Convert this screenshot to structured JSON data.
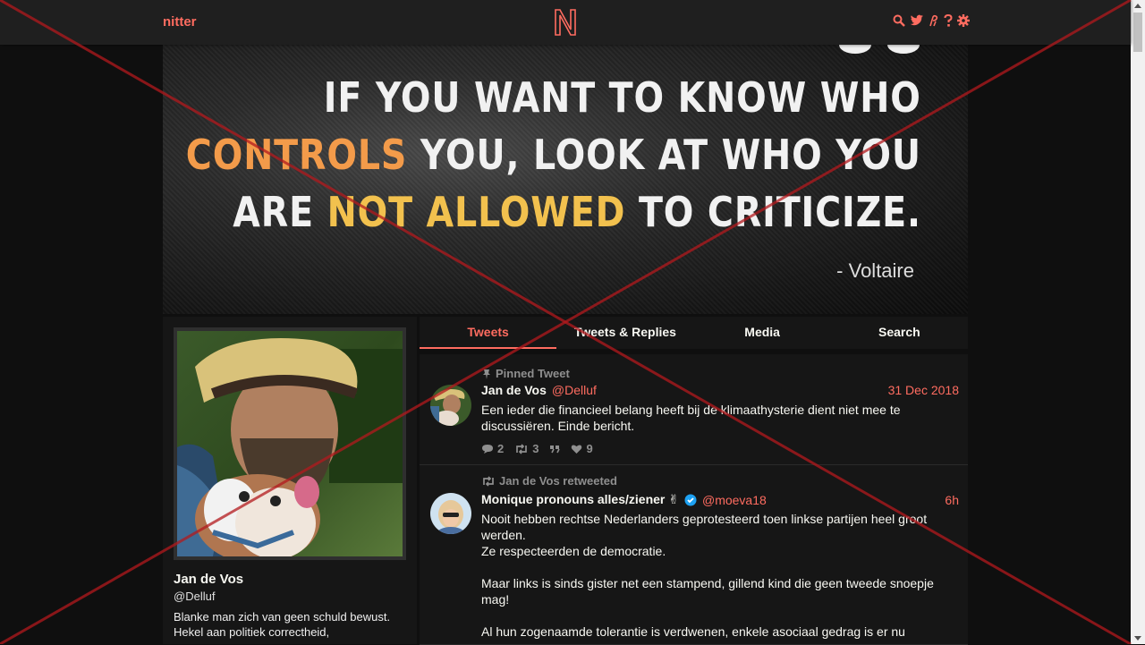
{
  "nav": {
    "brand": "nitter",
    "logo": "N",
    "icons": [
      "search-icon",
      "twitter-bird-icon",
      "rss-icon",
      "help-icon",
      "gear-icon"
    ]
  },
  "banner": {
    "line1": "IF YOU WANT TO KNOW WHO",
    "line2_highlight": "CONTROLS",
    "line2_rest": " YOU, LOOK AT WHO YOU",
    "line3_start": "ARE ",
    "line3_highlight": "NOT ALLOWED",
    "line3_rest": " TO CRITICIZE.",
    "author": "- Voltaire"
  },
  "profile": {
    "fullname": "Jan de Vos",
    "username": "@Delluf",
    "bio": "Blanke man zich van geen schuld bewust. Hekel aan politiek correctheid,"
  },
  "tabs": [
    {
      "label": "Tweets",
      "active": true
    },
    {
      "label": "Tweets & Replies",
      "active": false
    },
    {
      "label": "Media",
      "active": false
    },
    {
      "label": "Search",
      "active": false
    }
  ],
  "tweets": [
    {
      "meta": "Pinned Tweet",
      "name": "Jan de Vos",
      "handle": "@Delluf",
      "date": "31 Dec 2018",
      "text": [
        "Een ieder die financieel belang heeft bij de klimaathysterie dient niet mee te discussiëren. Einde bericht."
      ],
      "stats": {
        "replies": "2",
        "retweets": "3",
        "quotes": "",
        "likes": "9"
      }
    },
    {
      "meta": "Jan de Vos retweeted",
      "name": "Monique pronouns alles/ziener ✌",
      "handle": "@moeva18",
      "date": "6h",
      "text": [
        "Nooit hebben rechtse Nederlanders geprotesteerd toen linkse partijen heel groot werden.",
        "Ze respecteerden de democratie.",
        "",
        "Maar links is sinds gister net een stampend, gillend kind die geen tweede snoepje mag!",
        "",
        "Al hun zogenaamde tolerantie is verdwenen, enkele asociaal gedrag is er nu"
      ]
    }
  ],
  "colors": {
    "accent": "#ff6c60",
    "bg": "#0f0f0f",
    "panel": "#161616",
    "navbar": "#1f1f1f"
  }
}
